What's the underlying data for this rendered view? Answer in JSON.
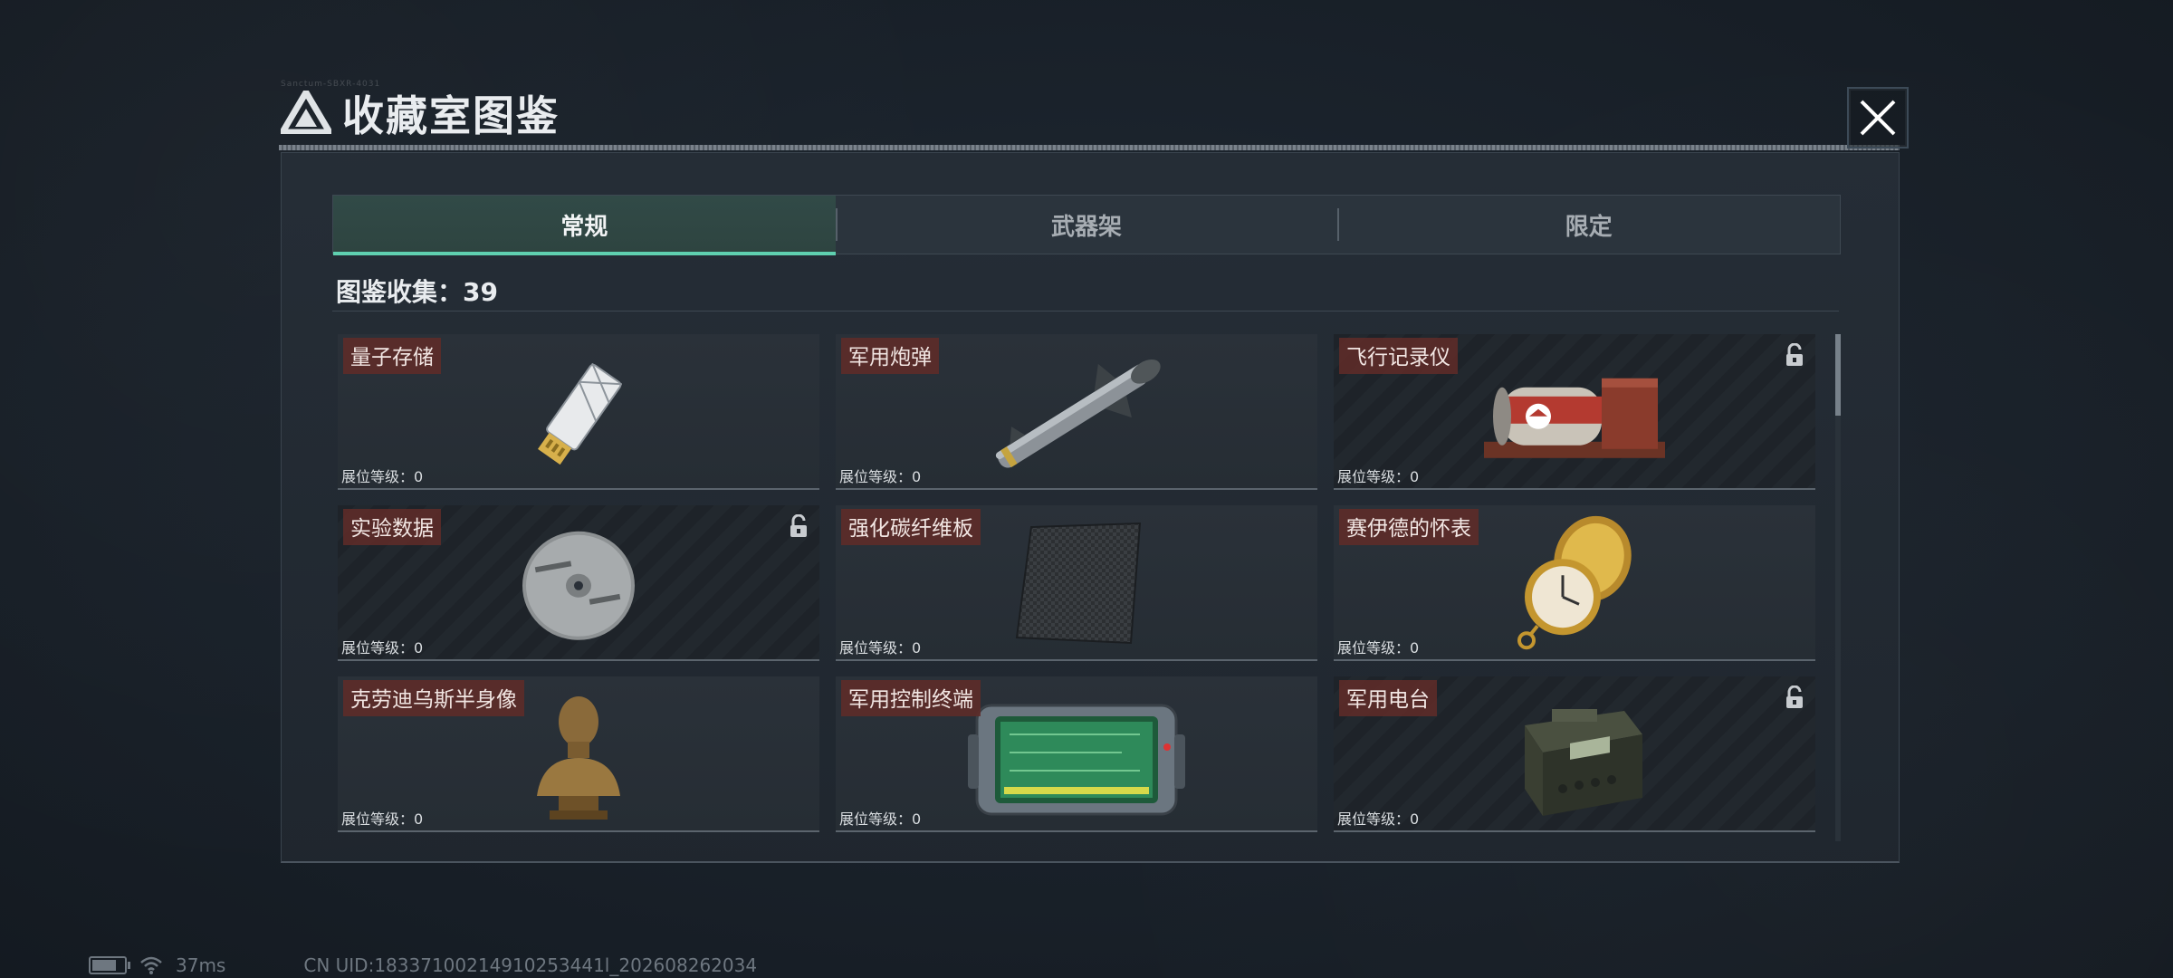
{
  "header": {
    "tiny_code": "Sanctum-SBXR-4031",
    "title": "收藏室图鉴"
  },
  "tabs": [
    {
      "label": "常规",
      "active": true
    },
    {
      "label": "武器架",
      "active": false
    },
    {
      "label": "限定",
      "active": false
    }
  ],
  "collection": {
    "text": "图鉴收集：39"
  },
  "items": [
    {
      "name": "量子存储",
      "level": "展位等级：0",
      "locked": false,
      "icon": "usb-drive-icon"
    },
    {
      "name": "军用炮弹",
      "level": "展位等级：0",
      "locked": false,
      "icon": "missile-icon"
    },
    {
      "name": "飞行记录仪",
      "level": "展位等级：0",
      "locked": true,
      "icon": "flight-recorder-icon"
    },
    {
      "name": "实验数据",
      "level": "展位等级：0",
      "locked": true,
      "icon": "disc-icon"
    },
    {
      "name": "强化碳纤维板",
      "level": "展位等级：0",
      "locked": false,
      "icon": "carbon-plate-icon"
    },
    {
      "name": "赛伊德的怀表",
      "level": "展位等级：0",
      "locked": false,
      "icon": "pocket-watch-icon"
    },
    {
      "name": "克劳迪乌斯半身像",
      "level": "展位等级：0",
      "locked": false,
      "icon": "bust-icon"
    },
    {
      "name": "军用控制终端",
      "level": "展位等级：0",
      "locked": false,
      "icon": "control-terminal-icon"
    },
    {
      "name": "军用电台",
      "level": "展位等级：0",
      "locked": true,
      "icon": "radio-icon"
    }
  ],
  "status_bar": {
    "ping": "37ms",
    "uid": "CN UID:18337100214910253441l_202608262034"
  },
  "colors": {
    "accent": "#5fd0b0",
    "label_bg": "#602c28"
  }
}
